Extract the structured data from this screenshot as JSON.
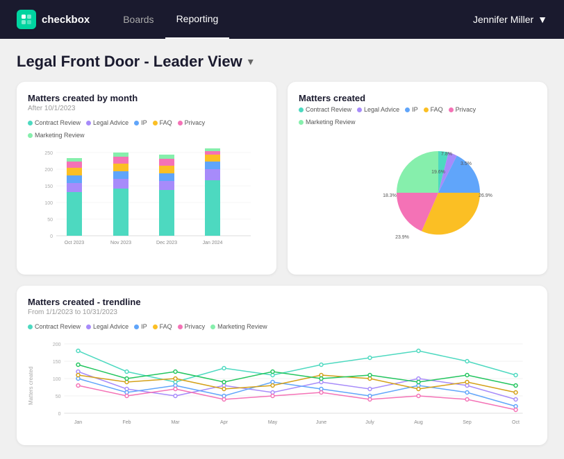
{
  "navbar": {
    "logo_text": "checkbox",
    "nav_links": [
      {
        "label": "Boards",
        "active": false
      },
      {
        "label": "Reporting",
        "active": true
      }
    ],
    "user": "Jennifer Miller"
  },
  "page": {
    "title": "Legal Front Door - Leader View"
  },
  "colors": {
    "contract_review": "#4dd9c0",
    "legal_advice": "#a78bfa",
    "ip": "#60a5fa",
    "faq": "#fbbf24",
    "privacy": "#f472b6",
    "marketing_review": "#86efac"
  },
  "bar_chart": {
    "title": "Matters created by month",
    "subtitle": "After 10/1/2023",
    "legend": [
      "Contract Review",
      "Legal Advice",
      "IP",
      "FAQ",
      "Privacy",
      "Marketing Review"
    ],
    "labels": [
      "Oct 2023",
      "Nov 2023",
      "Dec 2023",
      "Jan 2024"
    ],
    "y_labels": [
      "250",
      "200",
      "150",
      "100",
      "50",
      "0"
    ]
  },
  "pie_chart": {
    "title": "Matters created",
    "legend": [
      "Contract Review",
      "Legal Advice",
      "IP",
      "FAQ",
      "Privacy",
      "Marketing Review"
    ],
    "labels": [
      "7.8%",
      "3.5%",
      "19.6%",
      "26.9%",
      "23.9%",
      "18.3%"
    ]
  },
  "trendline_chart": {
    "title": "Matters created - trendline",
    "subtitle": "From 1/1/2023 to 10/31/2023",
    "legend": [
      "Contract Review",
      "Legal Advice",
      "IP",
      "FAQ",
      "Privacy",
      "Marketing Review"
    ],
    "x_labels": [
      "Jan",
      "Feb",
      "Mar",
      "Apr",
      "May",
      "June",
      "July",
      "Aug",
      "Sep",
      "Oct"
    ],
    "y_label": "Matters created"
  }
}
